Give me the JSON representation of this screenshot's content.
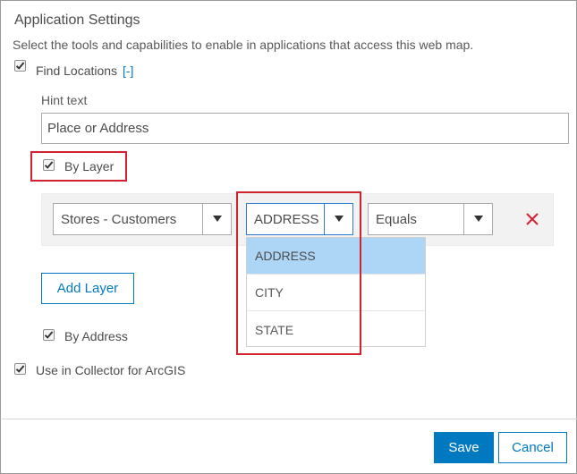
{
  "dialog": {
    "title": "Application Settings",
    "description": "Select the tools and capabilities to enable in applications that access this web map."
  },
  "find_locations": {
    "label": "Find Locations",
    "toggle": "[-]",
    "checked": true,
    "hint_label": "Hint text",
    "hint_value": "Place or Address",
    "by_layer": {
      "label": "By Layer",
      "checked": true
    },
    "layer_row": {
      "layer_select": "Stores - Customers",
      "field_select": "ADDRESS",
      "operator_select": "Equals",
      "field_options": [
        {
          "label": "ADDRESS",
          "selected": true
        },
        {
          "label": "CITY",
          "selected": false
        },
        {
          "label": "STATE",
          "selected": false
        }
      ]
    },
    "add_layer_label": "Add Layer",
    "by_address": {
      "label": "By Address",
      "checked": true
    }
  },
  "collector": {
    "label": "Use in Collector for ArcGIS",
    "checked": true
  },
  "footer": {
    "save_label": "Save",
    "cancel_label": "Cancel"
  },
  "colors": {
    "accent": "#0079c1",
    "highlight_red": "#d0232f",
    "selected_option": "#acd5f6"
  }
}
